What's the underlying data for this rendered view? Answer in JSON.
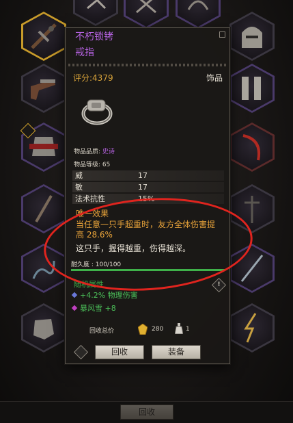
{
  "tooltip": {
    "item_name": "不朽锁铐",
    "item_type": "戒指",
    "score": "评分:4379",
    "category": "饰品",
    "quality_label": "物品品质: ",
    "quality_value": "史诗",
    "level_text": "物品等级: 65",
    "stats": [
      {
        "name": "威",
        "value": "17"
      },
      {
        "name": "敏",
        "value": "17"
      },
      {
        "name": "法术抗性",
        "value": "15%"
      }
    ],
    "unique_title": "唯一效果",
    "unique_desc": "当任意一只手超重时，友方全体伤害提高 28.6%",
    "flavor": "这只手，握得越重，伤得越深。",
    "durability_text": "耐久度 : 100/100",
    "durability_ratio": 1.0,
    "random_title": "随机属性",
    "affixes": [
      "+4.2% 物理伤害",
      "暴风雪 +8"
    ],
    "warn_icon": "!",
    "recycle_label": "回收总价",
    "recycle_gems": "280",
    "recycle_flasks": "1",
    "recycle_button": "回收",
    "equip_button": "装备"
  },
  "bottom_bar": {
    "recycle_button": "回收"
  },
  "colors": {
    "rarity_epic": "#b562e0",
    "unique": "#e8a33a",
    "affix": "#4cc25a",
    "durability": "#3fb14a",
    "annotation": "#e0241e"
  },
  "icons": {
    "slots_left": [
      "crossbow-icon",
      "pistol-icon",
      "armor-icon",
      "staff-icon",
      "flail-icon",
      "gauntlet-icon"
    ],
    "slots_right": [
      "helmet-icon",
      "greaves-icon",
      "scythe-icon",
      "polearm-icon",
      "katana-icon",
      "lightning-icon"
    ],
    "slots_top": [
      "bow-icon",
      "scissors-icon",
      "whip-icon",
      "rope-icon"
    ]
  }
}
